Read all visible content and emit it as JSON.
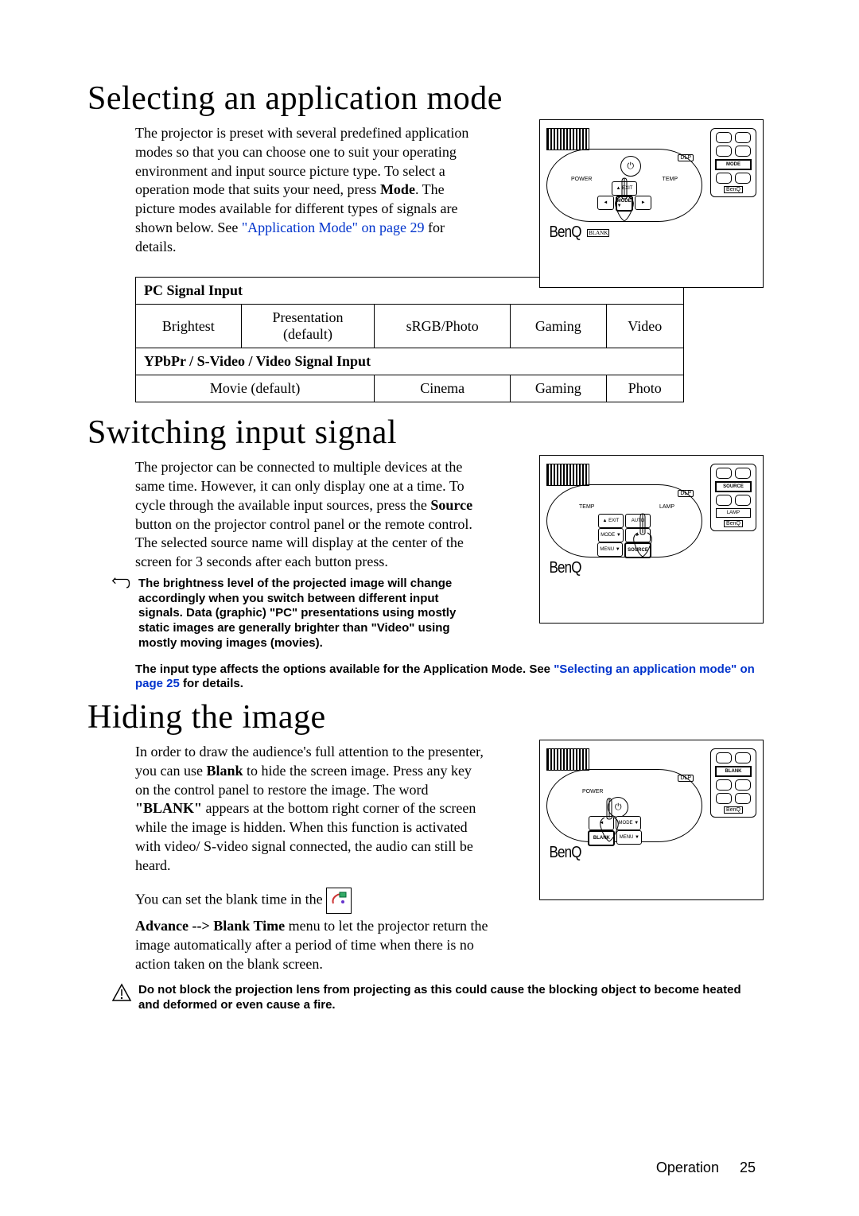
{
  "headings": {
    "h1": "Selecting an application mode",
    "h2": "Switching input signal",
    "h3": "Hiding the image"
  },
  "section1": {
    "p_pre": "The projector is preset with several predefined application modes so that you can choose one to suit your operating environment and input source picture type. To select a operation mode that suits your need, press ",
    "p_mode": "Mode",
    "p_mid": ". The picture modes available for different types of signals are shown below. See ",
    "p_link": "\"Application Mode\" on page 29",
    "p_post": " for details."
  },
  "table": {
    "hdr1": "PC Signal Input",
    "r1c1": "Brightest",
    "r1c2a": "Presentation",
    "r1c2b": "(default)",
    "r1c3": "sRGB/Photo",
    "r1c4": "Gaming",
    "r1c5": "Video",
    "hdr2": "YPbPr / S-Video / Video Signal Input",
    "r2c1": "Movie (default)",
    "r2c2": "Cinema",
    "r2c3": "Gaming",
    "r2c4": "Photo"
  },
  "section2": {
    "p_pre": "The projector can be connected to multiple devices at the same time. However, it can only display one at a time. To cycle through the available input sources, press the ",
    "p_source": "Source",
    "p_post": " button on the projector control panel or the remote control. The selected source name will display at the center of the screen for 3 seconds after each button press."
  },
  "note1": "The brightness level of the projected image will change accordingly when you switch between different input signals. Data (graphic) \"PC\" presentations using mostly static images are generally brighter than \"Video\" using mostly moving images (movies).",
  "note2_pre": "The input type affects the options available for the Application Mode. See ",
  "note2_link": "\"Selecting an application mode\" on page 25",
  "note2_post": " for details.",
  "section3": {
    "p1_pre": "In order to draw the audience's full attention to the presenter, you can use ",
    "p1_blank": "Blank",
    "p1_mid": " to hide the screen image. Press any key on the control panel to restore the image. The word ",
    "p1_q1": "\"",
    "p1_blankword": "BLANK",
    "p1_q2": "\"",
    "p1_post": " appears at the bottom right corner of the screen while the image is hidden. When this function is activated with video/ S-video signal connected, the audio can still be heard.",
    "p2_pre": "You can set the blank time in the ",
    "p3_pre": "Advance --> Blank Time",
    "p3_post": " menu to let the projector return the image automatically after a period of time when there is no action taken on the blank screen."
  },
  "warn": "Do not block the projection lens from projecting as this could cause the blocking object to become heated and deformed or even cause a fire.",
  "diagrams": {
    "logo": "BenQ",
    "dlp": "DLP",
    "power": "POWER",
    "temp": "TEMP",
    "lamp": "LAMP",
    "exit": "▲\nEXIT",
    "mode": "MODE\n▼",
    "menu": "MENU\n▼",
    "blank": "BLANK",
    "source": "SOURCE",
    "auto": "AUTO",
    "left": "◄",
    "right": "►",
    "remote_mode": "MODE",
    "remote_source": "SOURCE",
    "remote_blank": "BLANK",
    "remote_lamp": "LAMP",
    "benq_small": "BenQ"
  },
  "footer": {
    "section": "Operation",
    "page": "25"
  }
}
